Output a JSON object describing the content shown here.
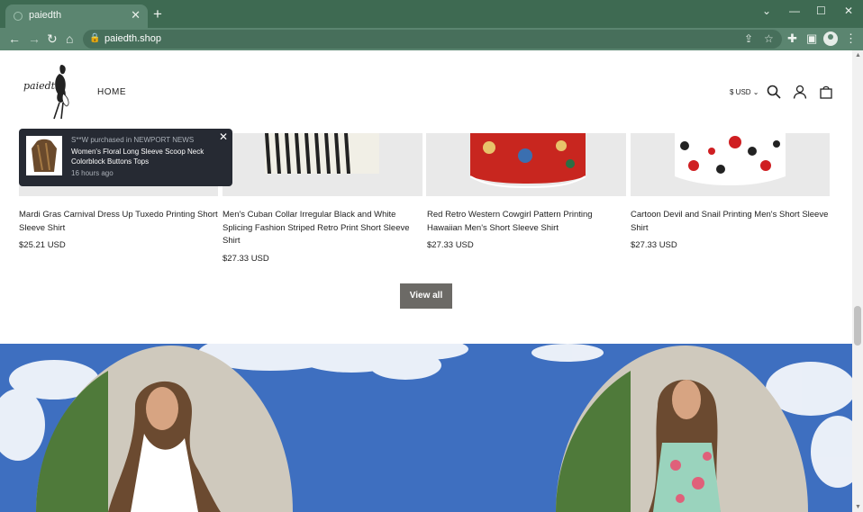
{
  "browser": {
    "tab_title": "paiedth",
    "tab_close": "✕",
    "new_tab": "+",
    "url": "paiedth.shop",
    "window_controls": {
      "dropdown": "⌄",
      "minimize": "—",
      "maximize": "☐",
      "close": "✕"
    }
  },
  "header": {
    "logo_text": "paiedth",
    "nav_home": "HOME",
    "currency": "$ USD"
  },
  "products": [
    {
      "title": "Mardi Gras Carnival Dress Up Tuxedo Printing Short Sleeve Shirt",
      "price": "$25.21 USD"
    },
    {
      "title": "Men's Cuban Collar Irregular Black and White Splicing Fashion Striped Retro Print Short Sleeve Shirt",
      "price": "$27.33 USD"
    },
    {
      "title": "Red Retro Western Cowgirl Pattern Printing Hawaiian Men's Short Sleeve Shirt",
      "price": "$27.33 USD"
    },
    {
      "title": "Cartoon Devil and Snail Printing Men's Short Sleeve Shirt",
      "price": "$27.33 USD"
    }
  ],
  "view_all_label": "View all",
  "popup": {
    "purchaser": "S**W purchased in NEWPORT NEWS",
    "product": "Women's Floral Long Sleeve Scoop Neck Colorblock Buttons Tops",
    "time": "16 hours ago",
    "close": "✕"
  },
  "colors": {
    "chrome": "#3e6a52",
    "toolbar": "#5b8570",
    "button": "#6c6a66",
    "popup": "#262a33",
    "banner_sky": "#3e6fc0"
  }
}
